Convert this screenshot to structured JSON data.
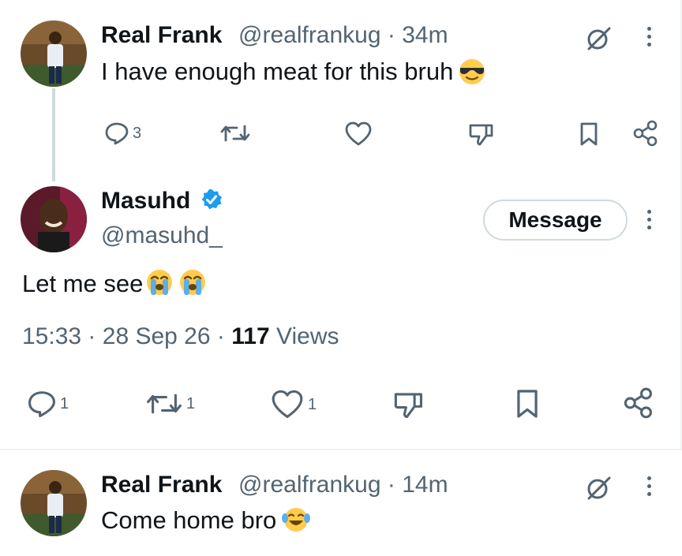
{
  "replies": [
    {
      "name": "Real Frank",
      "handle": "@realfrankug",
      "separator": "·",
      "time": "34m",
      "text": "I have enough meat for this bruh",
      "emoji": "sunglasses-face",
      "actions": {
        "reply_count": "3",
        "repost_count": "",
        "like_count": ""
      }
    },
    {
      "name": "Real Frank",
      "handle": "@realfrankug",
      "separator": "·",
      "time": "14m",
      "text": "Come home bro",
      "emoji": "tears-of-joy-face"
    }
  ],
  "main_tweet": {
    "name": "Masuhd",
    "verified": true,
    "handle": "@masuhd_",
    "message_button": "Message",
    "text": "Let me see",
    "emojis": [
      "loudly-crying-face",
      "loudly-crying-face"
    ],
    "time": "15:33",
    "dot": "·",
    "date": "28 Sep 26",
    "views_count": "117",
    "views_label": "Views",
    "actions": {
      "reply_count": "1",
      "repost_count": "1",
      "like_count": "1"
    }
  },
  "colors": {
    "verified_blue": "#1d9bf0",
    "secondary_text": "#536471",
    "primary_text": "#0f1419",
    "emoji_yellow": "#ffcc4d"
  }
}
